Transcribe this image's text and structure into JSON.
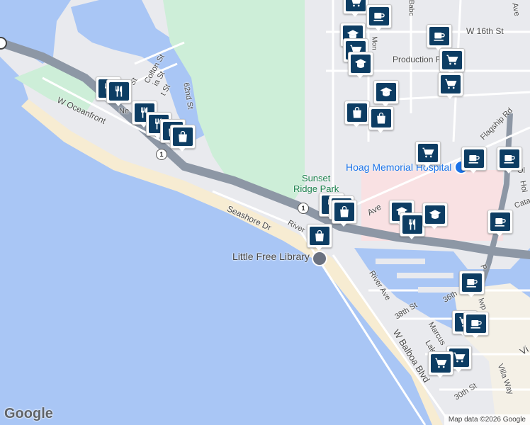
{
  "map": {
    "street_labels": [
      {
        "id": "w-16th-st",
        "text": "W 16th St"
      },
      {
        "id": "production-pl",
        "text": "Production Pl"
      },
      {
        "id": "flagship-rd",
        "text": "Flagship Rd"
      },
      {
        "id": "colton-st",
        "text": "Colton St"
      },
      {
        "id": "62nd-st",
        "text": "62nd St"
      },
      {
        "id": "w-oceanfront",
        "text": "W Oceanfront"
      },
      {
        "id": "seashore-dr",
        "text": "Seashore Dr"
      },
      {
        "id": "river-ave-1",
        "text": "River"
      },
      {
        "id": "river-ave-2",
        "text": "River Ave"
      },
      {
        "id": "38th-st",
        "text": "38th St"
      },
      {
        "id": "36th-st",
        "text": "36th"
      },
      {
        "id": "w-balboa-blvd",
        "text": "W Balboa Blvd"
      },
      {
        "id": "marcus-ave",
        "text": "Marcus"
      },
      {
        "id": "lake-ave",
        "text": "Lak"
      },
      {
        "id": "villa-way",
        "text": "Villa Way"
      },
      {
        "id": "30th-st",
        "text": "30th St"
      },
      {
        "id": "ave-top",
        "text": "Ave"
      },
      {
        "id": "babcock",
        "text": "Babc"
      },
      {
        "id": "monrovia",
        "text": "Mon"
      },
      {
        "id": "ave-mid",
        "text": "Ave"
      },
      {
        "id": "ne-st",
        "text": "Ne"
      },
      {
        "id": "ia-st",
        "text": "ia St"
      },
      {
        "id": "st-frag",
        "text": "St"
      },
      {
        "id": "t-st",
        "text": "t St"
      },
      {
        "id": "cata",
        "text": "Cata"
      },
      {
        "id": "ol",
        "text": "Ol"
      },
      {
        "id": "hol",
        "text": "Hol"
      },
      {
        "id": "vi",
        "text": "Vi"
      },
      {
        "id": "new-p",
        "text": "P"
      },
      {
        "id": "newp-ave",
        "text": "lwp"
      }
    ],
    "places": {
      "park": "Sunset\nRidge Park",
      "library": "Little Free Library",
      "hospital": "Hoag Memorial Hospital"
    },
    "route_shields": [
      "1",
      "1"
    ],
    "markers": [
      {
        "type": "shopping-cart"
      },
      {
        "type": "coffee"
      },
      {
        "type": "school"
      },
      {
        "type": "shopping-cart"
      },
      {
        "type": "school"
      },
      {
        "type": "coffee"
      },
      {
        "type": "shopping-cart"
      },
      {
        "type": "shopping-cart"
      },
      {
        "type": "school"
      },
      {
        "type": "shopping-bag"
      },
      {
        "type": "shopping-bag"
      },
      {
        "type": "restaurant"
      },
      {
        "type": "restaurant"
      },
      {
        "type": "restaurant"
      },
      {
        "type": "restaurant"
      },
      {
        "type": "shopping-bag"
      },
      {
        "type": "shopping-bag"
      },
      {
        "type": "shopping-cart"
      },
      {
        "type": "coffee"
      },
      {
        "type": "coffee"
      },
      {
        "type": "restaurant"
      },
      {
        "type": "restaurant"
      },
      {
        "type": "shopping-bag"
      },
      {
        "type": "shopping-bag"
      },
      {
        "type": "school"
      },
      {
        "type": "restaurant"
      },
      {
        "type": "school"
      },
      {
        "type": "coffee"
      },
      {
        "type": "coffee"
      },
      {
        "type": "shopping-cart"
      },
      {
        "type": "coffee"
      },
      {
        "type": "shopping-cart"
      },
      {
        "type": "shopping-cart"
      }
    ],
    "colors": {
      "water": "#a9c6f5",
      "land": "#e9eaee",
      "park": "#cdeed8",
      "beach": "#f7ecd2",
      "highway": "#8d97a5",
      "hospital": "#f9e1e3",
      "marker": "#0d3d63"
    }
  },
  "footer": {
    "logo": "Google",
    "attribution": "Map data ©2026 Google"
  }
}
